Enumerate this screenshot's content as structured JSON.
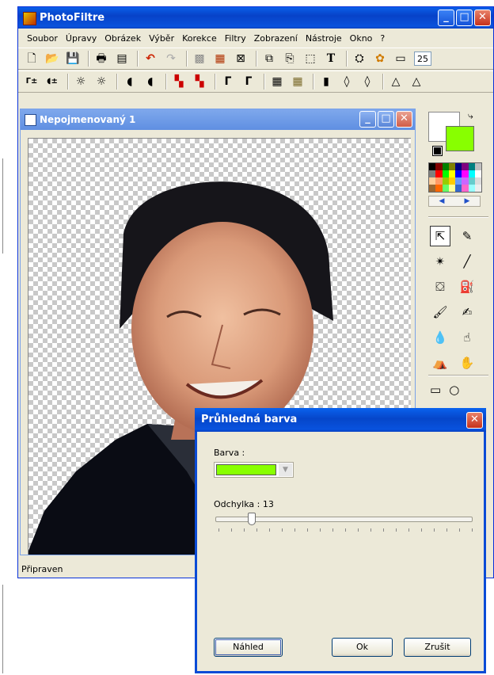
{
  "app": {
    "title": "PhotoFiltre",
    "menu": [
      "Soubor",
      "Úpravy",
      "Obrázek",
      "Výběr",
      "Korekce",
      "Filtry",
      "Zobrazení",
      "Nástroje",
      "Okno",
      "?"
    ],
    "zoom_value": "25",
    "status": "Připraven"
  },
  "document": {
    "title": "Nepojmenovaný 1"
  },
  "colors": {
    "foreground": "#ffffff",
    "background": "#88ff00",
    "palette": [
      "#000000",
      "#800000",
      "#008000",
      "#808000",
      "#000080",
      "#800080",
      "#008080",
      "#c0c0c0",
      "#808080",
      "#ff0000",
      "#00ff00",
      "#ffff00",
      "#0000ff",
      "#ff00ff",
      "#00ffff",
      "#ffffff",
      "#ffcc99",
      "#ff9966",
      "#99cc00",
      "#ffcc00",
      "#6699ff",
      "#cc66ff",
      "#66cccc",
      "#dddddd",
      "#996633",
      "#ff6600",
      "#66ff66",
      "#ffff99",
      "#3366cc",
      "#ff66cc",
      "#99ffff",
      "#eeeeee"
    ]
  },
  "dialog": {
    "title": "Průhledná barva",
    "color_label": "Barva :",
    "color_value": "#88ff00",
    "tolerance_label": "Odchylka : 13",
    "tolerance_value": 13,
    "tolerance_max": 100,
    "preview_button": "Náhled",
    "ok_button": "Ok",
    "cancel_button": "Zrušit"
  }
}
